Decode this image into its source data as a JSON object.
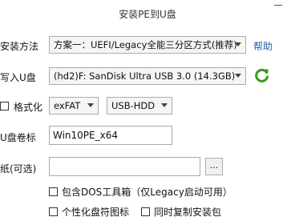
{
  "window": {
    "title": "安装PE到U盘"
  },
  "install_method": {
    "label": "安装方法",
    "value": "方案一：UEFI/Legacy全能三分区方式(推荐)",
    "help_link": "帮助"
  },
  "target_usb": {
    "label": "写入U盘",
    "value": "(hd2)F: SanDisk Ultra USB 3.0 (14.3GB)"
  },
  "format": {
    "label": "格式化",
    "filesystem": "exFAT",
    "mode": "USB-HDD"
  },
  "volume_label": {
    "label": "U盘卷标",
    "value": "Win10PE_x64"
  },
  "wallpaper": {
    "label": "纸(可选)",
    "value": "",
    "browse": "..."
  },
  "options": {
    "dos_tools": "包含DOS工具箱（仅Legacy启动可用）",
    "personalize": "个性化盘符图标",
    "copy_package": "同时复制安装包"
  }
}
